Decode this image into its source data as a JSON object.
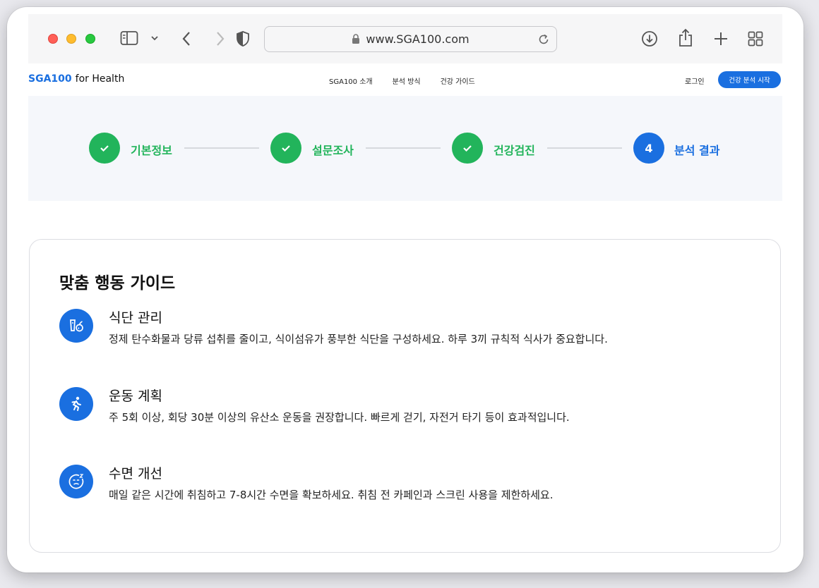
{
  "browser": {
    "url": "www.SGA100.com",
    "icons": [
      "sidebar-icon",
      "chevron-down-icon",
      "back-icon",
      "forward-icon",
      "shield-icon",
      "lock-icon",
      "reload-icon",
      "download-icon",
      "share-icon",
      "plus-icon",
      "tabs-grid-icon"
    ]
  },
  "header": {
    "brand": "SGA100",
    "brand_suffix": "for Health",
    "nav": [
      "SGA100 소개",
      "분석 방식",
      "건강 가이드"
    ],
    "login": "로그인",
    "cta": "건강 분석 시작"
  },
  "stepper": {
    "steps": [
      {
        "label": "기본정보",
        "status": "done"
      },
      {
        "label": "설문조사",
        "status": "done"
      },
      {
        "label": "건강검진",
        "status": "done"
      },
      {
        "label": "분석 결과",
        "status": "active",
        "number": "4"
      }
    ]
  },
  "guide": {
    "title": "맞춤 행동 가이드",
    "items": [
      {
        "icon": "diet-icon",
        "heading": "식단 관리",
        "text": "정제 탄수화물과 당류 섭취를 줄이고, 식이섬유가 풍부한 식단을 구성하세요. 하루 3끼 규칙적 식사가 중요합니다."
      },
      {
        "icon": "running-icon",
        "heading": "운동 계획",
        "text": "주 5회 이상, 회당 30분 이상의 유산소 운동을 권장합니다. 빠르게 걷기, 자전거 타기 등이 효과적입니다."
      },
      {
        "icon": "sleep-icon",
        "heading": "수면 개선",
        "text": "매일 같은 시간에 취침하고 7-8시간 수면을 확보하세요. 취침 전 카페인과 스크린 사용을 제한하세요."
      }
    ]
  },
  "colors": {
    "primary": "#1a6fe0",
    "success": "#22b45b",
    "stepper_bg": "#f5f7fb"
  }
}
